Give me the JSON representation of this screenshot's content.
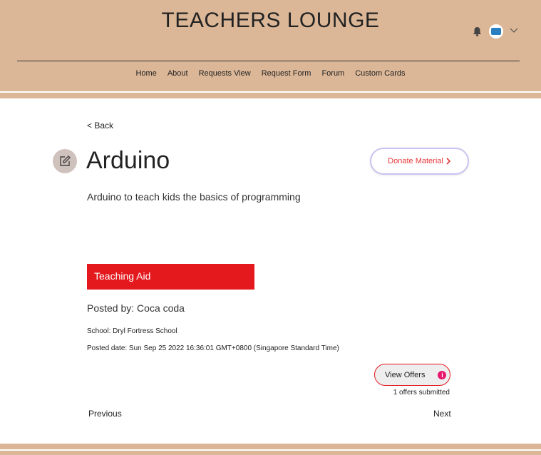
{
  "header": {
    "title": "TEACHERS LOUNGE",
    "nav": [
      "Home",
      "About",
      "Requests View",
      "Request Form",
      "Forum",
      "Custom Cards"
    ]
  },
  "icons": {
    "notifications": "bell-icon",
    "avatar": "user-avatar",
    "menu": "chevron-down-icon",
    "edit": "pencil-icon",
    "info": "info-icon"
  },
  "colors": {
    "header_bg": "#dbb797",
    "accent_red": "#e3191e",
    "info_pink": "#e8176e"
  },
  "page": {
    "back": "< Back",
    "title": "Arduino",
    "donate": "Donate Material",
    "description": "Arduino to teach kids the basics of programming",
    "category": "Teaching Aid",
    "posted_by": "Posted by: Coca coda",
    "school": "School: Dryl Fortress School",
    "posted_date": "Posted date: Sun Sep 25 2022 16:36:01 GMT+0800 (Singapore Standard Time)",
    "view_offers": "View Offers",
    "info_glyph": "i",
    "offers_submitted": "1 offers submitted",
    "previous": "Previous",
    "next": "Next"
  }
}
